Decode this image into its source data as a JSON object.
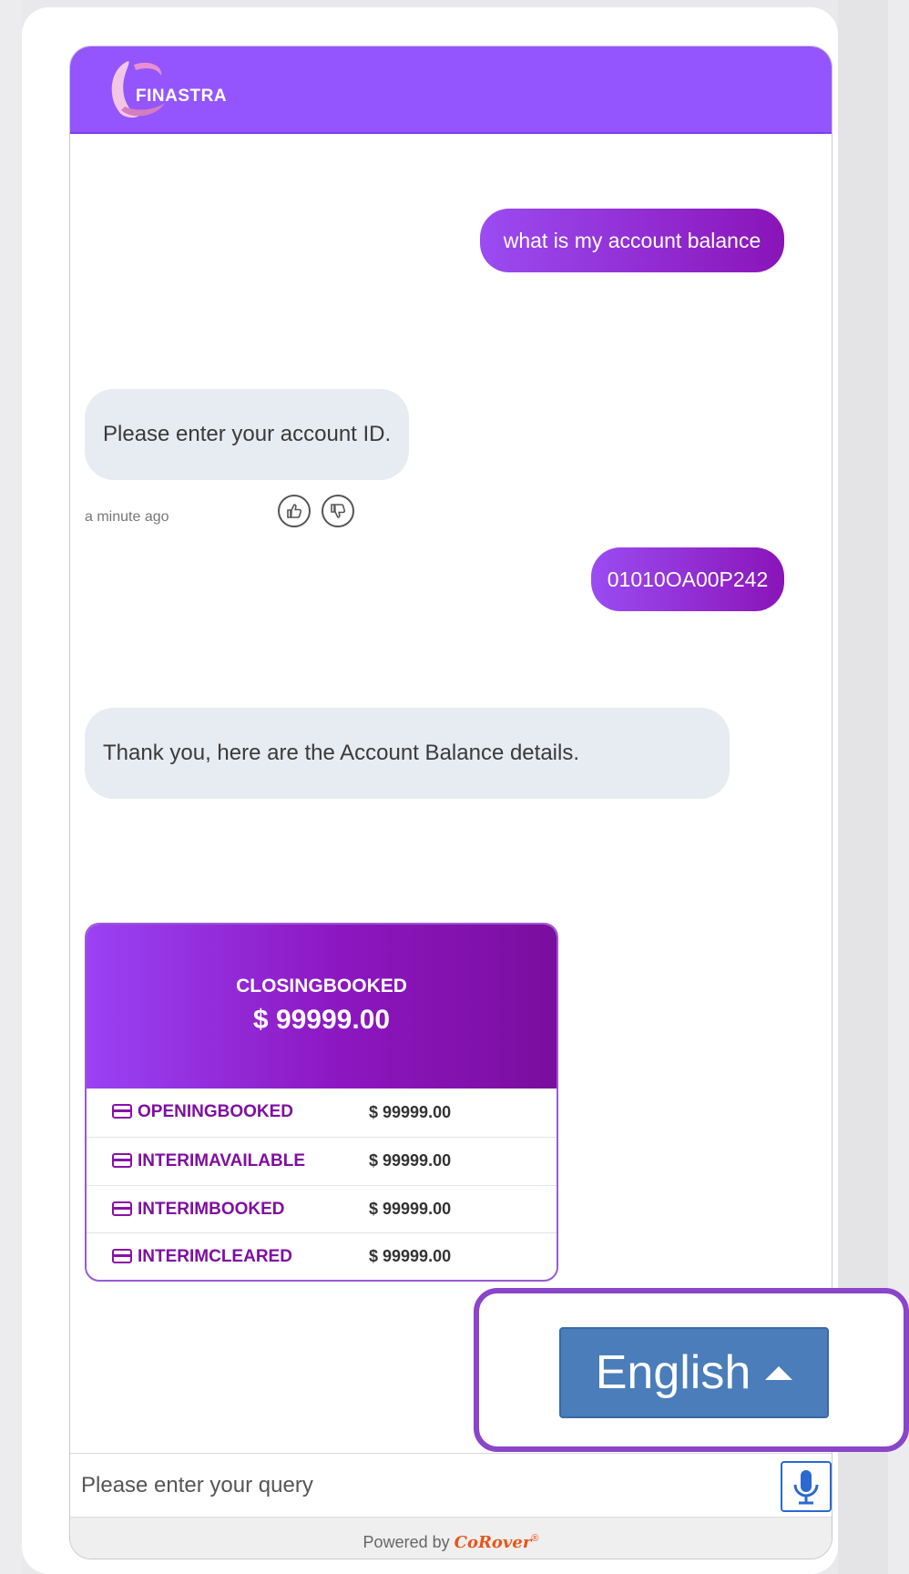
{
  "header": {
    "brand": "FINASTRA"
  },
  "messages": [
    {
      "from": "user",
      "text": "what is my account balance"
    },
    {
      "from": "bot",
      "text": "Please enter your account ID.",
      "time": "a minute ago"
    },
    {
      "from": "user",
      "text": "01010OA00P242"
    },
    {
      "from": "bot",
      "text": "Thank you, here are the Account Balance details."
    }
  ],
  "balance_card": {
    "headline_label": "CLOSINGBOOKED",
    "headline_amount": "$ 99999.00",
    "rows": [
      {
        "label": "OPENINGBOOKED",
        "value": "$ 99999.00"
      },
      {
        "label": "INTERIMAVAILABLE",
        "value": "$ 99999.00"
      },
      {
        "label": "INTERIMBOOKED",
        "value": "$ 99999.00"
      },
      {
        "label": "INTERIMCLEARED",
        "value": "$ 99999.00"
      }
    ]
  },
  "language": {
    "selected": "English"
  },
  "input": {
    "placeholder": "Please enter your query"
  },
  "footer": {
    "powered_by": "Powered by",
    "brand": "CoRover",
    "reg": "®"
  }
}
